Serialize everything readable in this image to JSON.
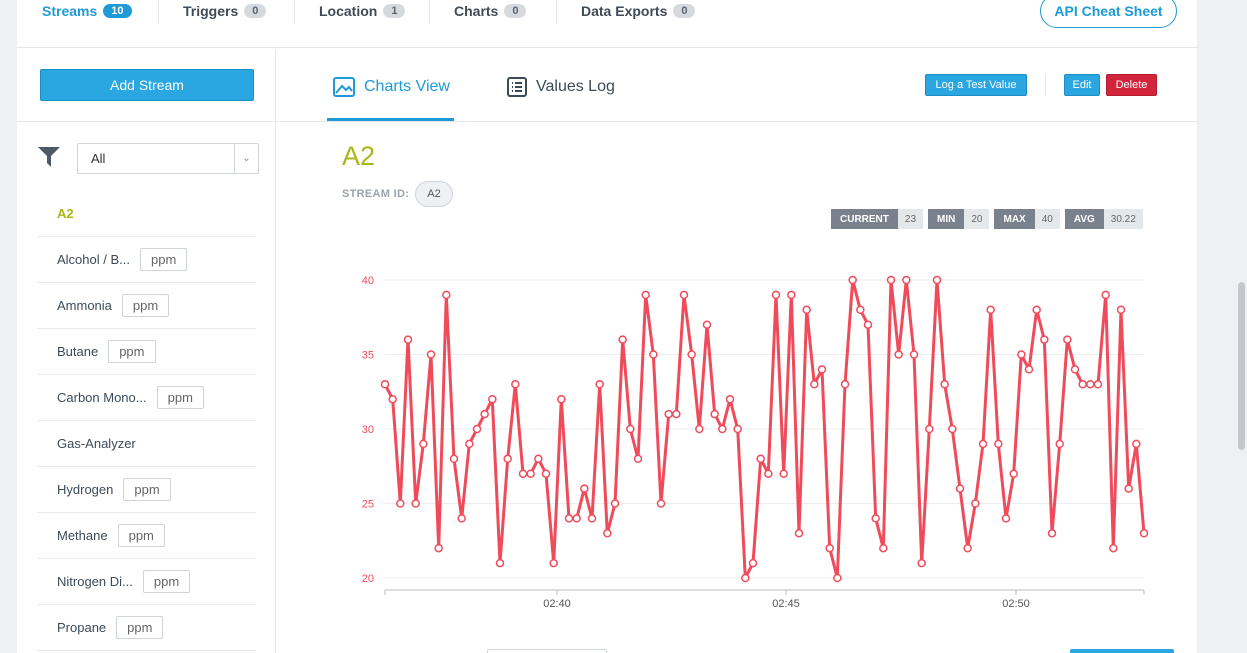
{
  "top_tabs": [
    {
      "label": "Streams",
      "count": "10"
    },
    {
      "label": "Triggers",
      "count": "0"
    },
    {
      "label": "Location",
      "count": "1"
    },
    {
      "label": "Charts",
      "count": "0"
    },
    {
      "label": "Data Exports",
      "count": "0"
    }
  ],
  "api_button": "API Cheat Sheet",
  "sidebar": {
    "add_stream": "Add Stream",
    "filter_value": "All",
    "streams": [
      {
        "name": "A2",
        "unit": ""
      },
      {
        "name": "Alcohol / B...",
        "unit": "ppm"
      },
      {
        "name": "Ammonia",
        "unit": "ppm"
      },
      {
        "name": "Butane",
        "unit": "ppm"
      },
      {
        "name": "Carbon Mono...",
        "unit": "ppm"
      },
      {
        "name": "Gas-Analyzer",
        "unit": ""
      },
      {
        "name": "Hydrogen",
        "unit": "ppm"
      },
      {
        "name": "Methane",
        "unit": "ppm"
      },
      {
        "name": "Nitrogen Di...",
        "unit": "ppm"
      },
      {
        "name": "Propane",
        "unit": "ppm"
      }
    ]
  },
  "view_tabs": {
    "charts": "Charts View",
    "values": "Values Log"
  },
  "actions": {
    "log_test": "Log a Test Value",
    "edit": "Edit",
    "delete": "Delete"
  },
  "stream": {
    "title": "A2",
    "id_label": "STREAM ID:",
    "id": "A2"
  },
  "stats": [
    {
      "label": "CURRENT",
      "value": "23"
    },
    {
      "label": "MIN",
      "value": "20"
    },
    {
      "label": "MAX",
      "value": "40"
    },
    {
      "label": "AVG",
      "value": "30.22"
    }
  ],
  "colors": {
    "accent": "#1e9ad6",
    "title": "#a8b81a",
    "series": "#ef4b5a",
    "delete": "#d2253c"
  },
  "chart_data": {
    "type": "line",
    "ylim": [
      20,
      40
    ],
    "yticks": [
      40,
      35,
      30,
      25,
      20
    ],
    "xticks": [
      "02:40",
      "02:45",
      "02:50"
    ],
    "series": [
      {
        "values": [
          33,
          32,
          25,
          36,
          25,
          29,
          35,
          22,
          39,
          28,
          24,
          29,
          30,
          31,
          32,
          21,
          28,
          33,
          27,
          27,
          28,
          27,
          21,
          32,
          24,
          24,
          26,
          24,
          33,
          23,
          25,
          36,
          30,
          28,
          39,
          35,
          25,
          31,
          31,
          39,
          35,
          30,
          37,
          31,
          30,
          32,
          30,
          20,
          21,
          28,
          27,
          39,
          27,
          39,
          23,
          38,
          33,
          34,
          22,
          20,
          33,
          40,
          38,
          37,
          24,
          22,
          40,
          35,
          40,
          35,
          21,
          30,
          40,
          33,
          30,
          26,
          22,
          25,
          29,
          38,
          29,
          24,
          27,
          35,
          34,
          38,
          36,
          23,
          29,
          36,
          34,
          33,
          33,
          33,
          39,
          22,
          38,
          26,
          29,
          23
        ]
      }
    ]
  }
}
